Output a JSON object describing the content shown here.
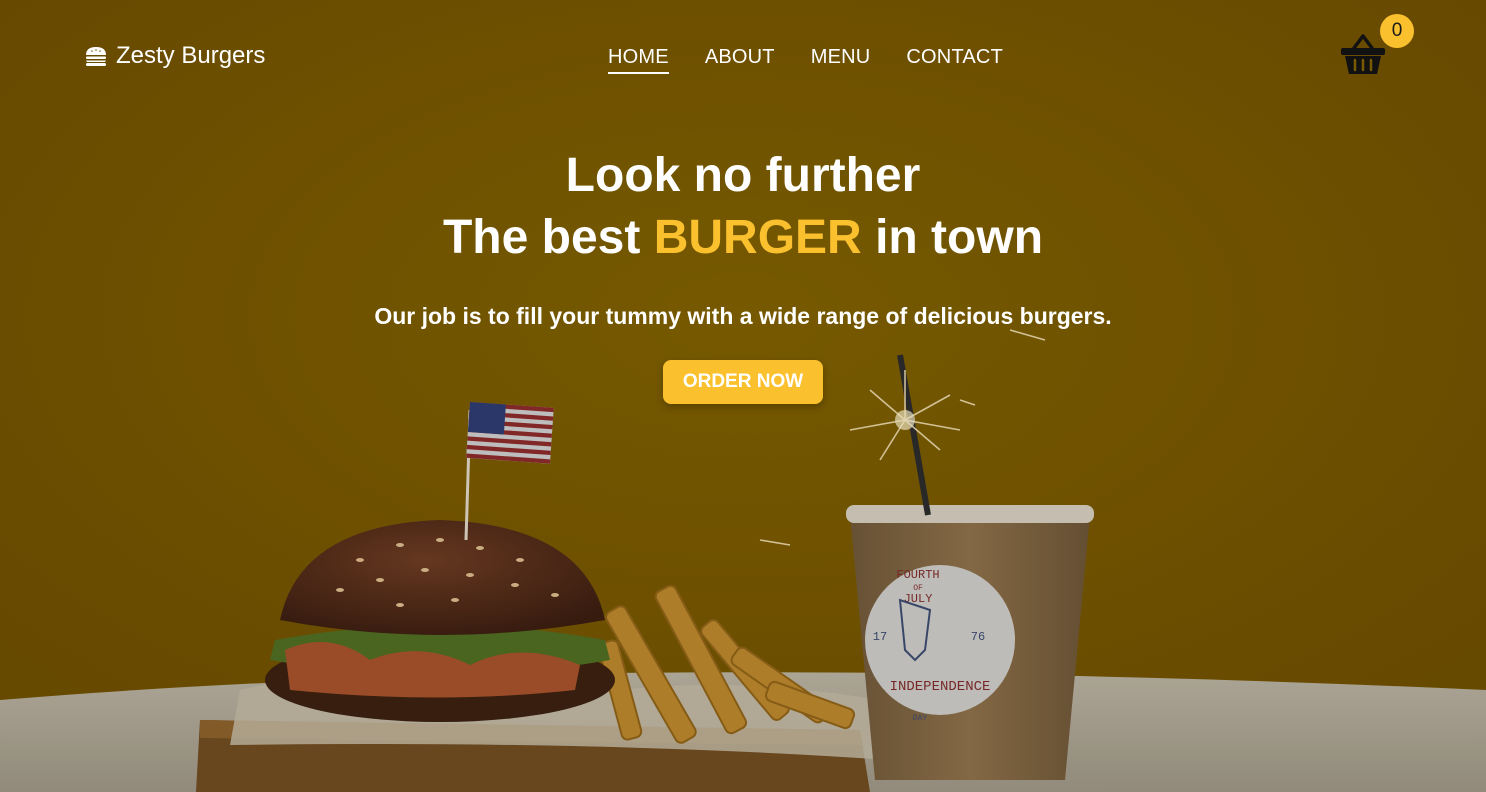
{
  "brand": {
    "name": "Zesty Burgers",
    "icon": "burger-icon"
  },
  "nav": {
    "items": [
      {
        "label": "HOME",
        "active": true
      },
      {
        "label": "ABOUT",
        "active": false
      },
      {
        "label": "MENU",
        "active": false
      },
      {
        "label": "CONTACT",
        "active": false
      }
    ]
  },
  "cart": {
    "icon": "basket-icon",
    "count": "0"
  },
  "hero": {
    "headline_line1": "Look no further",
    "headline_prefix": "The best",
    "headline_accent": "BURGER",
    "headline_suffix": "in town",
    "tagline": "Our job is to fill your tummy with a wide range of delicious burgers.",
    "cta_label": "ORDER NOW"
  },
  "colors": {
    "accent": "#fbc02d",
    "background": "#7a5a00",
    "text": "#ffffff"
  },
  "scene": {
    "cup_text": [
      "FOURTH",
      "OF",
      "JULY",
      "17",
      "76",
      "INDEPENDENCE",
      "DAY"
    ]
  }
}
